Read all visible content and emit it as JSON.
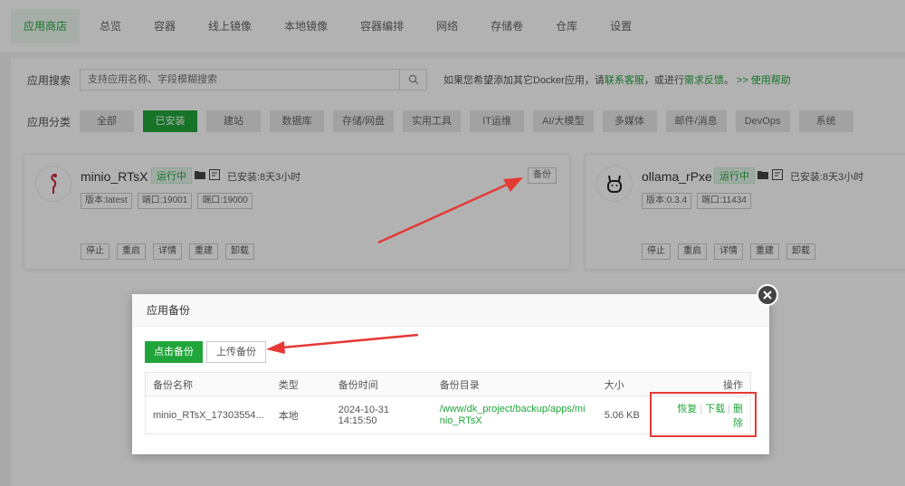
{
  "nav": {
    "tabs": [
      "应用商店",
      "总览",
      "容器",
      "线上镜像",
      "本地镜像",
      "容器编排",
      "网络",
      "存储卷",
      "仓库",
      "设置"
    ],
    "active_index": 0
  },
  "search": {
    "label": "应用搜索",
    "placeholder": "支持应用名称、字段模糊搜索",
    "tip_prefix": "如果您希望添加其它Docker应用，请",
    "tip_link1": "联系客服",
    "tip_mid": "，或进行",
    "tip_link2": "需求反馈",
    "tip_sep": "。",
    "tip_link3": ">> 使用帮助"
  },
  "categories": {
    "label": "应用分类",
    "items": [
      "全部",
      "已安装",
      "建站",
      "数据库",
      "存储/网盘",
      "实用工具",
      "IT运维",
      "AI/大模型",
      "多媒体",
      "邮件/消息",
      "DevOps",
      "系统"
    ],
    "active_index": 1
  },
  "apps": [
    {
      "name": "minio_RTsX",
      "status": "运行中",
      "installed": "已安装:8天3小时",
      "version": "版本:latest",
      "port1": "端口:19001",
      "port2": "端口:19000",
      "backup_label": "备份",
      "ops": [
        "停止",
        "重启",
        "详情",
        "重建",
        "卸载"
      ]
    },
    {
      "name": "ollama_rPxe",
      "status": "运行中",
      "installed": "已安装:8天3小时",
      "version": "版本:0.3.4",
      "port1": "端口:11434",
      "ops": [
        "停止",
        "重启",
        "详情",
        "重建",
        "卸载"
      ]
    }
  ],
  "modal": {
    "title": "应用备份",
    "btn_backup": "点击备份",
    "btn_upload": "上传备份",
    "columns": [
      "备份名称",
      "类型",
      "备份时间",
      "备份目录",
      "大小",
      "操作"
    ],
    "rows": [
      {
        "name": "minio_RTsX_17303554...",
        "type": "本地",
        "time": "2024-10-31 14:15:50",
        "path": "/www/dk_project/backup/apps/minio_RTsX",
        "size": "5.06 KB",
        "actions": [
          "恢复",
          "下载",
          "删除"
        ]
      }
    ]
  },
  "colors": {
    "accent": "#20a53a",
    "highlight": "#e53935"
  }
}
